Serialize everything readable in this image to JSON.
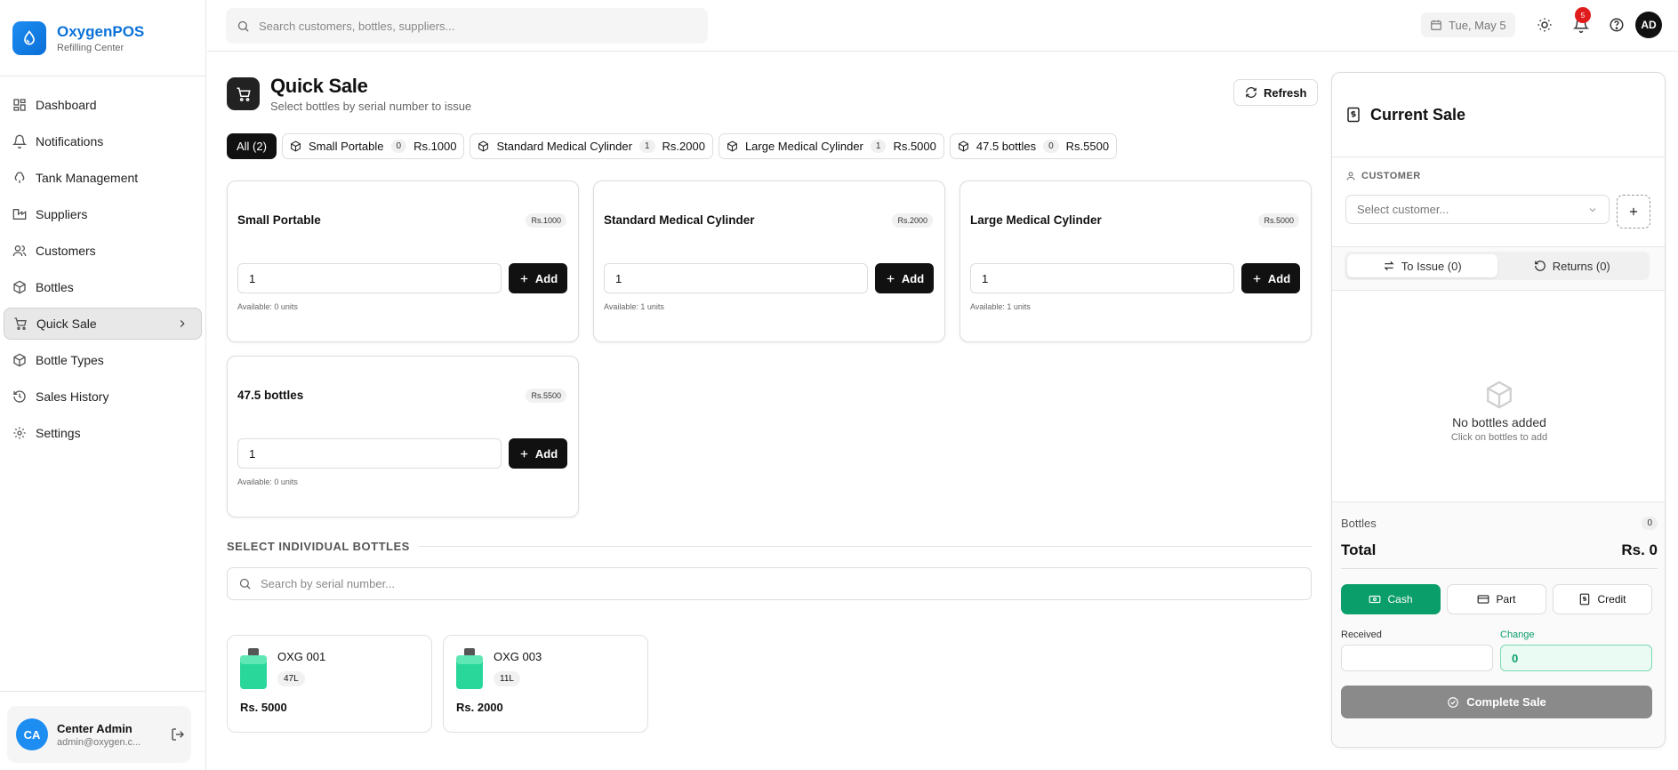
{
  "app": {
    "name": "OxygenPOS",
    "subtitle": "Refilling Center"
  },
  "sidebar": {
    "items": [
      {
        "label": "Dashboard",
        "icon": "dashboard-icon"
      },
      {
        "label": "Notifications",
        "icon": "bell-icon"
      },
      {
        "label": "Tank Management",
        "icon": "tank-icon"
      },
      {
        "label": "Suppliers",
        "icon": "factory-icon"
      },
      {
        "label": "Customers",
        "icon": "users-icon"
      },
      {
        "label": "Bottles",
        "icon": "package-icon"
      },
      {
        "label": "Quick Sale",
        "icon": "cart-icon",
        "active": true
      },
      {
        "label": "Bottle Types",
        "icon": "package-icon"
      },
      {
        "label": "Sales History",
        "icon": "history-icon"
      },
      {
        "label": "Settings",
        "icon": "gear-icon"
      }
    ],
    "user": {
      "initials": "CA",
      "name": "Center Admin",
      "email": "admin@oxygen.c..."
    }
  },
  "topbar": {
    "search_placeholder": "Search customers, bottles, suppliers...",
    "date": "Tue, May 5",
    "notification_count": "5",
    "user_initials": "AD"
  },
  "page": {
    "title": "Quick Sale",
    "subtitle": "Select bottles by serial number to issue",
    "refresh_label": "Refresh"
  },
  "filters": [
    {
      "label": "All (2)",
      "active": true
    },
    {
      "label": "Small Portable",
      "count": "0",
      "price": "Rs.1000"
    },
    {
      "label": "Standard Medical Cylinder",
      "count": "1",
      "price": "Rs.2000"
    },
    {
      "label": "Large Medical Cylinder",
      "count": "1",
      "price": "Rs.5000"
    },
    {
      "label": "47.5 bottles",
      "count": "0",
      "price": "Rs.5500"
    }
  ],
  "types": [
    {
      "name": "Small Portable",
      "price": "Rs.1000",
      "qty": "1",
      "add": "Add",
      "available": "Available: 0 units"
    },
    {
      "name": "Standard Medical Cylinder",
      "price": "Rs.2000",
      "qty": "1",
      "add": "Add",
      "available": "Available: 1 units"
    },
    {
      "name": "Large Medical Cylinder",
      "price": "Rs.5000",
      "qty": "1",
      "add": "Add",
      "available": "Available: 1 units"
    },
    {
      "name": "47.5 bottles",
      "price": "Rs.5500",
      "qty": "1",
      "add": "Add",
      "available": "Available: 0 units"
    }
  ],
  "individual": {
    "title": "SELECT INDIVIDUAL BOTTLES",
    "search_placeholder": "Search by serial number...",
    "bottles": [
      {
        "code": "OXG 001",
        "size": "47L",
        "price": "Rs. 5000"
      },
      {
        "code": "OXG 003",
        "size": "11L",
        "price": "Rs. 2000"
      }
    ]
  },
  "sale": {
    "title": "Current Sale",
    "customer_label": "CUSTOMER",
    "customer_placeholder": "Select customer...",
    "tab_issue": "To Issue (0)",
    "tab_returns": "Returns (0)",
    "empty_title": "No bottles added",
    "empty_sub": "Click on bottles to add",
    "bottles_label": "Bottles",
    "bottles_count": "0",
    "total_label": "Total",
    "total_value": "Rs. 0",
    "pay_cash": "Cash",
    "pay_part": "Part",
    "pay_credit": "Credit",
    "received_label": "Received",
    "change_label": "Change",
    "change_value": "0",
    "complete_label": "Complete Sale"
  },
  "colors": {
    "brand": "#0b72d9",
    "accent_green": "#0a9e6a",
    "dark": "#111111",
    "badge_red": "#e01b1b"
  }
}
